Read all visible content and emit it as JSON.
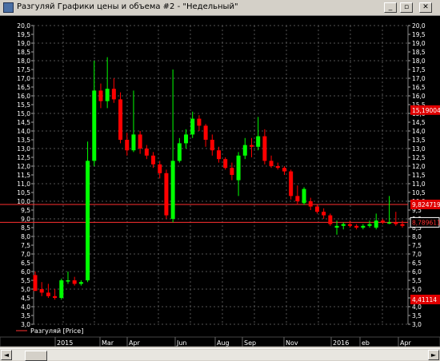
{
  "window": {
    "title": "Разгуляй Графики цены и объема #2 - \"Недельный\"",
    "minimize": "_",
    "restore": "▫",
    "close": "✕"
  },
  "colors": {
    "up": "#00ff00",
    "down": "#ff0000",
    "grid": "#555555",
    "axis_text": "#ffffff",
    "hline": "#ff3030",
    "background": "#000000"
  },
  "legend": {
    "label": "Разгуляй [Price]"
  },
  "chart_data": {
    "type": "candlestick",
    "left_axis_labels": [
      "20,0",
      "19,5",
      "19,0",
      "18,5",
      "18,0",
      "17,5",
      "17,0",
      "16,5",
      "16,0",
      "15,5",
      "15,0",
      "14,5",
      "14,0",
      "13,5",
      "13,0",
      "12,5",
      "12,0",
      "11,5",
      "11,0",
      "10,5",
      "10,0",
      "9,5",
      "9,0",
      "8,5",
      "8,0",
      "7,5",
      "7,0",
      "6,5",
      "6,0",
      "5,5",
      "5,0",
      "4,5",
      "4,0",
      "3,5",
      "3,0"
    ],
    "right_axis": {
      "min": 3.0,
      "max": 20.0,
      "step": 0.5
    },
    "right_axis_labels": [
      "20,0",
      "19,5",
      "19,0",
      "18,5",
      "18,0",
      "17,5",
      "17,0",
      "16,5",
      "16,0",
      "15,5",
      "15,0",
      "14,5",
      "14,0",
      "13,5",
      "13,0",
      "12,5",
      "12,0",
      "11,5",
      "11,0",
      "10,5",
      "10,0",
      "9,5",
      "9,0",
      "8,5",
      "8,0",
      "7,5",
      "7,0",
      "6,5",
      "6,0",
      "5,5",
      "5,0",
      "4,5",
      "4,0",
      "3,5",
      "3,0"
    ],
    "x_labels": [
      "2015",
      "Mar",
      "Apr",
      "Jun",
      "Aug",
      "Sep",
      "Nov",
      "2016",
      "eb",
      "Apr"
    ],
    "price_tags": [
      {
        "value": 15.19,
        "text": "15,19004",
        "style": "filled"
      },
      {
        "value": 9.82,
        "text": "9,824719",
        "style": "filled"
      },
      {
        "value": 8.8,
        "text": "8,789611",
        "style": "boxed"
      },
      {
        "value": 4.41,
        "text": "4,41114",
        "style": "filled"
      }
    ],
    "hlines": [
      9.82,
      8.8
    ],
    "candles": [
      {
        "o": 5.8,
        "h": 6.0,
        "l": 4.9,
        "c": 4.9
      },
      {
        "o": 5.0,
        "h": 5.4,
        "l": 4.6,
        "c": 4.8
      },
      {
        "o": 4.8,
        "h": 5.3,
        "l": 4.5,
        "c": 4.6
      },
      {
        "o": 4.6,
        "h": 5.0,
        "l": 4.4,
        "c": 4.5
      },
      {
        "o": 4.5,
        "h": 5.6,
        "l": 4.4,
        "c": 5.5
      },
      {
        "o": 5.5,
        "h": 6.0,
        "l": 5.3,
        "c": 5.5
      },
      {
        "o": 5.5,
        "h": 5.7,
        "l": 5.2,
        "c": 5.3
      },
      {
        "o": 5.3,
        "h": 5.5,
        "l": 5.2,
        "c": 5.4
      },
      {
        "o": 5.5,
        "h": 13.4,
        "l": 5.4,
        "c": 12.3
      },
      {
        "o": 12.3,
        "h": 18.0,
        "l": 12.0,
        "c": 16.3
      },
      {
        "o": 16.3,
        "h": 16.7,
        "l": 15.3,
        "c": 15.7
      },
      {
        "o": 15.7,
        "h": 18.2,
        "l": 15.3,
        "c": 16.4
      },
      {
        "o": 16.4,
        "h": 17.0,
        "l": 15.6,
        "c": 15.8
      },
      {
        "o": 15.8,
        "h": 16.2,
        "l": 13.3,
        "c": 13.5
      },
      {
        "o": 13.5,
        "h": 13.9,
        "l": 12.6,
        "c": 12.9
      },
      {
        "o": 12.9,
        "h": 16.3,
        "l": 12.8,
        "c": 13.8
      },
      {
        "o": 13.8,
        "h": 14.0,
        "l": 12.7,
        "c": 13.0
      },
      {
        "o": 13.0,
        "h": 13.2,
        "l": 12.4,
        "c": 12.6
      },
      {
        "o": 12.6,
        "h": 12.8,
        "l": 11.9,
        "c": 12.1
      },
      {
        "o": 12.1,
        "h": 12.3,
        "l": 11.3,
        "c": 11.6
      },
      {
        "o": 11.6,
        "h": 11.8,
        "l": 9.0,
        "c": 9.2
      },
      {
        "o": 9.0,
        "h": 17.5,
        "l": 8.8,
        "c": 12.3
      },
      {
        "o": 12.3,
        "h": 13.6,
        "l": 12.2,
        "c": 13.3
      },
      {
        "o": 13.3,
        "h": 14.1,
        "l": 13.0,
        "c": 13.8
      },
      {
        "o": 13.8,
        "h": 15.1,
        "l": 13.6,
        "c": 14.7
      },
      {
        "o": 14.7,
        "h": 14.9,
        "l": 14.0,
        "c": 14.3
      },
      {
        "o": 14.3,
        "h": 14.4,
        "l": 13.1,
        "c": 13.5
      },
      {
        "o": 13.5,
        "h": 13.8,
        "l": 12.6,
        "c": 12.9
      },
      {
        "o": 12.9,
        "h": 13.1,
        "l": 12.2,
        "c": 12.4
      },
      {
        "o": 12.4,
        "h": 12.5,
        "l": 11.8,
        "c": 11.9
      },
      {
        "o": 11.9,
        "h": 12.2,
        "l": 11.2,
        "c": 11.5
      },
      {
        "o": 11.2,
        "h": 12.8,
        "l": 10.3,
        "c": 12.6
      },
      {
        "o": 12.6,
        "h": 13.6,
        "l": 12.4,
        "c": 13.2
      },
      {
        "o": 13.2,
        "h": 13.6,
        "l": 12.5,
        "c": 13.1
      },
      {
        "o": 13.1,
        "h": 14.8,
        "l": 12.9,
        "c": 13.7
      },
      {
        "o": 13.7,
        "h": 14.1,
        "l": 12.1,
        "c": 12.3
      },
      {
        "o": 12.3,
        "h": 12.6,
        "l": 11.9,
        "c": 12.0
      },
      {
        "o": 12.0,
        "h": 12.2,
        "l": 11.8,
        "c": 11.9
      },
      {
        "o": 11.9,
        "h": 12.0,
        "l": 11.5,
        "c": 11.7
      },
      {
        "o": 11.7,
        "h": 11.8,
        "l": 10.1,
        "c": 10.3
      },
      {
        "o": 10.3,
        "h": 10.9,
        "l": 9.8,
        "c": 10.0
      },
      {
        "o": 9.9,
        "h": 10.8,
        "l": 9.8,
        "c": 10.7
      },
      {
        "o": 10.0,
        "h": 10.2,
        "l": 9.5,
        "c": 9.7
      },
      {
        "o": 9.7,
        "h": 9.8,
        "l": 9.3,
        "c": 9.4
      },
      {
        "o": 9.4,
        "h": 9.6,
        "l": 9.0,
        "c": 9.2
      },
      {
        "o": 9.2,
        "h": 9.3,
        "l": 8.6,
        "c": 8.7
      },
      {
        "o": 8.5,
        "h": 8.9,
        "l": 8.1,
        "c": 8.6
      },
      {
        "o": 8.6,
        "h": 8.8,
        "l": 8.4,
        "c": 8.7
      },
      {
        "o": 8.7,
        "h": 8.9,
        "l": 8.5,
        "c": 8.6
      },
      {
        "o": 8.6,
        "h": 8.7,
        "l": 8.4,
        "c": 8.5
      },
      {
        "o": 8.5,
        "h": 8.7,
        "l": 8.4,
        "c": 8.6
      },
      {
        "o": 8.6,
        "h": 8.9,
        "l": 8.5,
        "c": 8.7
      },
      {
        "o": 8.5,
        "h": 9.3,
        "l": 8.4,
        "c": 8.9
      },
      {
        "o": 8.9,
        "h": 9.0,
        "l": 8.7,
        "c": 8.8
      },
      {
        "o": 8.8,
        "h": 10.3,
        "l": 8.7,
        "c": 8.8
      },
      {
        "o": 8.8,
        "h": 9.4,
        "l": 8.6,
        "c": 8.7
      },
      {
        "o": 8.7,
        "h": 8.9,
        "l": 8.5,
        "c": 8.6
      }
    ]
  }
}
